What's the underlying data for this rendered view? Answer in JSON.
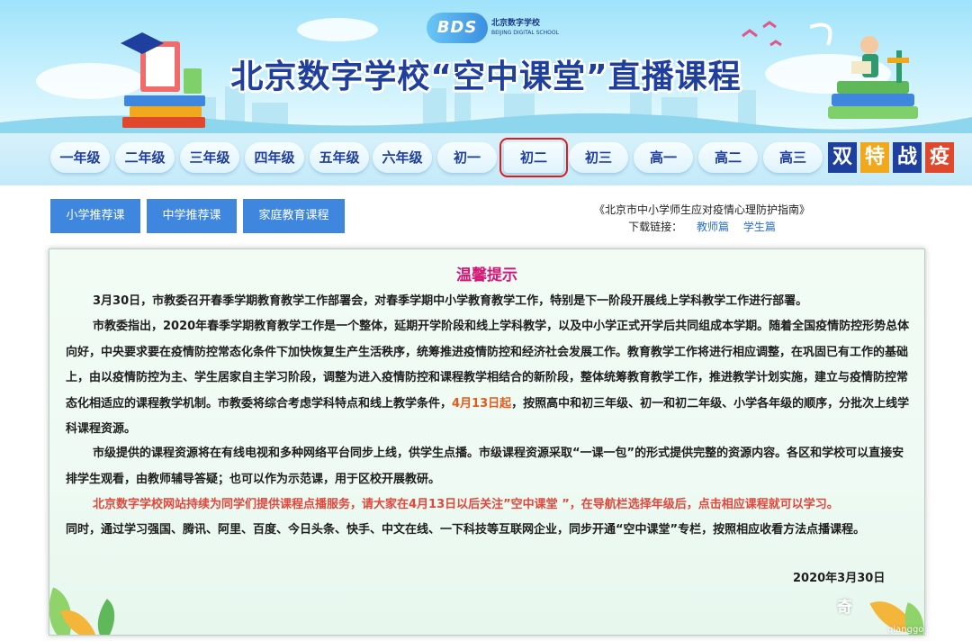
{
  "banner": {
    "logo_mark": "BDS",
    "logo_name_cn": "北京数字学校",
    "logo_name_en": "BEIJING DIGITAL SCHOOL",
    "title": "北京数字学校“空中课堂”直播课程"
  },
  "grades": [
    {
      "label": "一年级",
      "selected": false
    },
    {
      "label": "二年级",
      "selected": false
    },
    {
      "label": "三年级",
      "selected": false
    },
    {
      "label": "四年级",
      "selected": false
    },
    {
      "label": "五年级",
      "selected": false
    },
    {
      "label": "六年级",
      "selected": false
    },
    {
      "label": "初一",
      "selected": false
    },
    {
      "label": "初二",
      "selected": true
    },
    {
      "label": "初三",
      "selected": false
    },
    {
      "label": "高一",
      "selected": false
    },
    {
      "label": "高二",
      "selected": false
    },
    {
      "label": "高三",
      "selected": false
    }
  ],
  "slogan": {
    "chars": [
      "双",
      "特",
      "战",
      "疫"
    ],
    "colors": [
      "#1f3f9e",
      "#f2a81c",
      "#1f3f9e",
      "#e0482d"
    ]
  },
  "sub_nav": {
    "primary_courses": "小学推荐课",
    "secondary_courses": "中学推荐课",
    "family_courses": "家庭教育课程"
  },
  "guide": {
    "title": "《北京市中小学师生应对疫情心理防护指南》",
    "download_label": "下载链接：",
    "teacher_link": "教师篇",
    "student_link": "学生篇"
  },
  "notice": {
    "title": "温馨提示",
    "p1": "3月30日，市教委召开春季学期教育教学工作部署会，对春季学期中小学教育教学工作，特别是下一阶段开展线上学科教学工作进行部署。",
    "p2_before": "市教委指出，2020年春季学期教育教学工作是一个整体，延期开学阶段和线上学科教学，以及中小学正式开学后共同组成本学期。随着全国疫情防控形势总体向好，中央要求要在疫情防控常态化条件下加快恢复生产生活秩序，统筹推进疫情防控和经济社会发展工作。教育教学工作将进行相应调整，在巩固已有工作的基础上，由以疫情防控为主、学生居家自主学习阶段，调整为进入疫情防控和课程教学相结合的新阶段，整体统筹教育教学工作，推进教学计划实施，建立与疫情防控常态化相适应的课程教学机制。市教委将综合考虑学科特点和线上教学条件，",
    "p2_highlight": "4月13日起",
    "p2_after": "，按照高中和初三年级、初一和初二年级、小学各年级的顺序，分批次上线学科课程资源。",
    "p3": "市级提供的课程资源将在有线电视和多种网络平台同步上线，供学生点播。市级课程资源采取“一课一包”的形式提供完整的资源内容。各区和学校可以直接安排学生观看，由教师辅导答疑；也可以作为示范课，用于区校开展教研。",
    "p4": "北京数字学校网站持续为同学们提供课程点播服务，请大家在4月13日以后关注”空中课堂 ”，在导航栏选择年级后，点击相应课程就可以学习。",
    "p5": "同时，通过学习强国、腾讯、阿里、百度、今日头条、快手、中文在线、一下科技等互联网企业，同步开通“空中课堂”专栏，按照相应收看方法点播课程。",
    "date": "2020年3月30日"
  },
  "watermark": {
    "text": "奇",
    "sub": "qianggo"
  }
}
